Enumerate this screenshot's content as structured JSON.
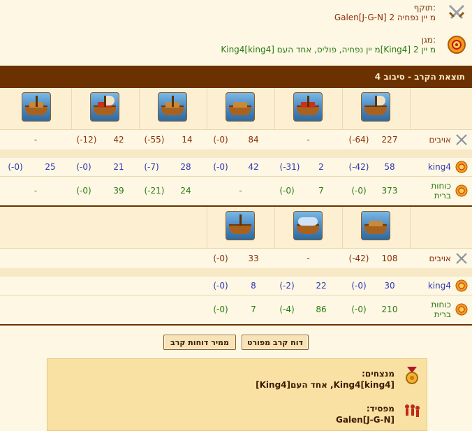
{
  "attacker": {
    "label": "תוקף:",
    "value": "Galen[J-G-N] מ יין נפחיה 2"
  },
  "defender": {
    "label": "מגן:",
    "value": "King4[king4] מ יין נפחיה, פוליס, אחד העם[King4] מ יין 2"
  },
  "round_title": "תוצאת הקרב - סיבוב 4",
  "rows": {
    "enemies": "אויבים",
    "own": "king4",
    "allies": "כוחות ברית"
  },
  "table1": {
    "enemies": [
      {
        "count": "227",
        "loss": "(-64)"
      },
      {
        "count": "-",
        "loss": ""
      },
      {
        "count": "84",
        "loss": "(-0)"
      },
      {
        "count": "14",
        "loss": "(-55)"
      },
      {
        "count": "42",
        "loss": "(-12)"
      },
      {
        "count": "-",
        "loss": ""
      }
    ],
    "own": [
      {
        "count": "58",
        "loss": "(-42)"
      },
      {
        "count": "2",
        "loss": "(-31)"
      },
      {
        "count": "42",
        "loss": "(-0)"
      },
      {
        "count": "28",
        "loss": "(-7)"
      },
      {
        "count": "21",
        "loss": "(-0)"
      },
      {
        "count": "25",
        "loss": "(-0)"
      }
    ],
    "allies": [
      {
        "count": "373",
        "loss": "(-0)"
      },
      {
        "count": "7",
        "loss": "(-0)"
      },
      {
        "count": "-",
        "loss": ""
      },
      {
        "count": "24",
        "loss": "(-21)"
      },
      {
        "count": "39",
        "loss": "(-0)"
      },
      {
        "count": "-",
        "loss": ""
      }
    ]
  },
  "table2": {
    "enemies": [
      {
        "count": "108",
        "loss": "(-42)"
      },
      {
        "count": "-",
        "loss": ""
      },
      {
        "count": "33",
        "loss": "(-0)"
      }
    ],
    "own": [
      {
        "count": "30",
        "loss": "(-0)"
      },
      {
        "count": "22",
        "loss": "(-2)"
      },
      {
        "count": "8",
        "loss": "(-0)"
      }
    ],
    "allies": [
      {
        "count": "210",
        "loss": "(-0)"
      },
      {
        "count": "86",
        "loss": "(-4)"
      },
      {
        "count": "7",
        "loss": "(-0)"
      }
    ]
  },
  "buttons": {
    "detailed": "דוח קרב מפורט",
    "back": "ממיר דוחות קרב"
  },
  "summary": {
    "winners_label": "מנצחים:",
    "winners_value": "King4[king4], אחד העם[King4]",
    "loser_label": "מפסיד:",
    "loser_value": "Galen[J-G-N]"
  }
}
